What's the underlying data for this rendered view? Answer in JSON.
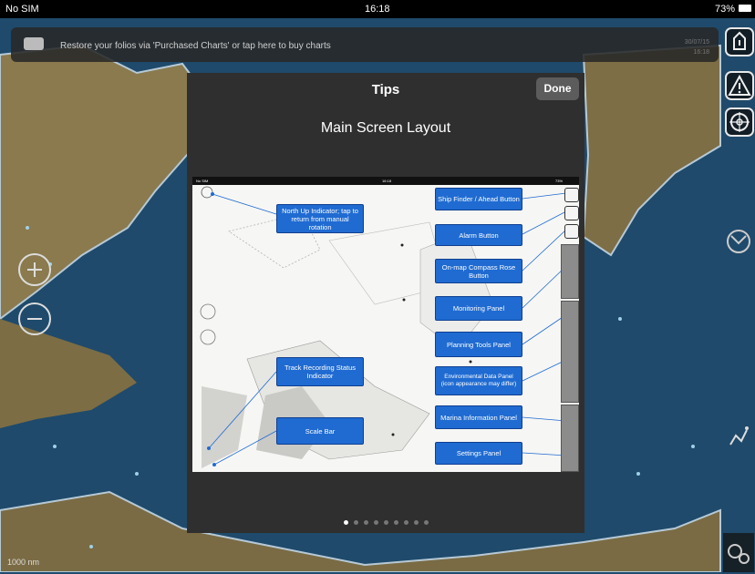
{
  "status_bar": {
    "carrier": "No SIM",
    "time": "16:18",
    "battery": "73%"
  },
  "banner": {
    "message": "Restore your folios via 'Purchased Charts' or tap here to buy charts",
    "date": "30/07/15",
    "time": "16:18"
  },
  "map": {
    "scale_label": "1000 nm"
  },
  "tips": {
    "title": "Tips",
    "done_label": "Done",
    "subtitle": "Main Screen Layout",
    "callouts": {
      "north_up": "North Up Indicator; tap to return from manual rotation",
      "ship_finder": "Ship Finder / Ahead Button",
      "alarm": "Alarm Button",
      "compass_rose": "On-map Compass Rose Button",
      "monitoring": "Monitoring Panel",
      "planning": "Planning Tools Panel",
      "environmental": "Environmental Data Panel (icon appearance may differ)",
      "marina": "Marina Information Panel",
      "settings": "Settings Panel",
      "track_recording": "Track Recording Status Indicator",
      "scale_bar": "Scale Bar"
    },
    "mini_status": {
      "carrier": "No SIM",
      "time": "16:18",
      "battery": "73%"
    },
    "page_count": 9,
    "current_page": 1
  },
  "colors": {
    "callout_blue": "#1f6bd2",
    "modal_bg": "#2f2f2f",
    "sea": "#1f4a6b"
  },
  "icons": [
    "chat-bubble-icon",
    "ship-finder-icon",
    "alarm-icon",
    "compass-rose-icon",
    "monitoring-icon",
    "planning-tools-icon",
    "settings-icon",
    "zoom-in-icon",
    "zoom-out-icon"
  ]
}
